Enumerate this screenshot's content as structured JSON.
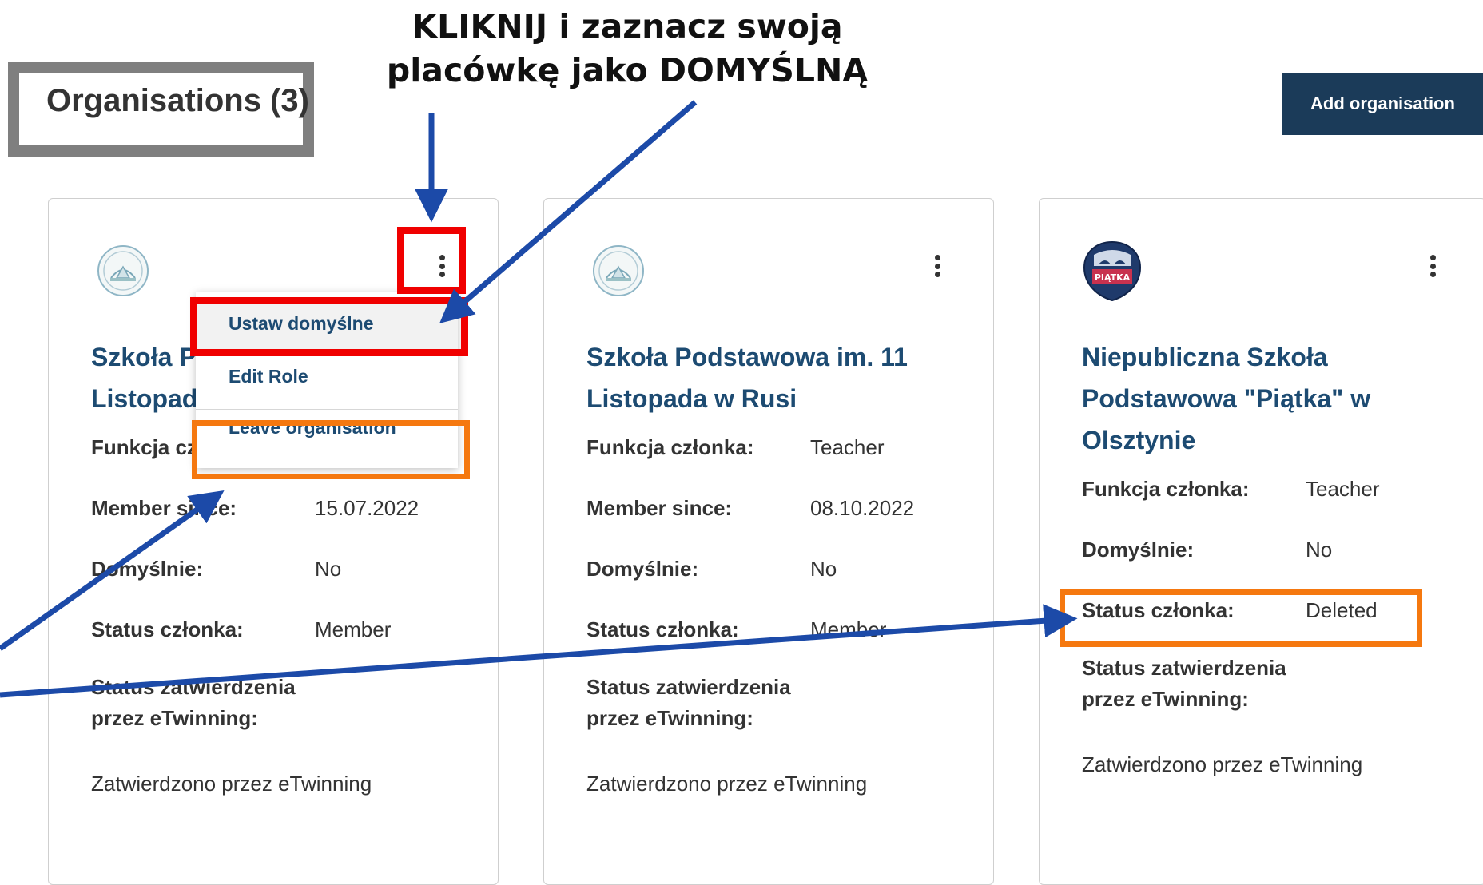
{
  "header": {
    "title": "Organisations (3)",
    "add_button": "Add organisation"
  },
  "annotation": {
    "line1": "KLIKNIJ i zaznacz swoją",
    "line2": "placówkę jako DOMYŚLNĄ"
  },
  "dropdown": {
    "items": [
      "Ustaw domyślne",
      "Edit Role",
      "Leave organisation"
    ]
  },
  "cards": [
    {
      "name_line1": "Szkoła P",
      "name_line2": "Listopad",
      "function_label": "Funkcja cz",
      "function_value": "",
      "member_since_label": "Member since:",
      "member_since_value": "15.07.2022",
      "default_label": "Domyślnie:",
      "default_value": "No",
      "status_label": "Status członka:",
      "status_value": "Member",
      "etwinning_label": "Status zatwierdzenia przez eTwinning:",
      "etwinning_value": "Zatwierdzono przez eTwinning"
    },
    {
      "name": "Szkoła Podstawowa im. 11 Listopada w Rusi",
      "function_label": "Funkcja członka:",
      "function_value": "Teacher",
      "member_since_label": "Member since:",
      "member_since_value": "08.10.2022",
      "default_label": "Domyślnie:",
      "default_value": "No",
      "status_label": "Status członka:",
      "status_value": "Member",
      "etwinning_label": "Status zatwierdzenia przez eTwinning:",
      "etwinning_value": "Zatwierdzono przez eTwinning"
    },
    {
      "name": "Niepubliczna Szkoła Podstawowa \"Piątka\" w Olsztynie",
      "logo_text": "PIĄTKA",
      "function_label": "Funkcja członka:",
      "function_value": "Teacher",
      "default_label": "Domyślnie:",
      "default_value": "No",
      "status_label": "Status członka:",
      "status_value": "Deleted",
      "etwinning_label": "Status zatwierdzenia przez eTwinning:",
      "etwinning_value": "Zatwierdzono przez eTwinning"
    }
  ],
  "colors": {
    "primary": "#1b3b59",
    "link": "#1d4b72",
    "highlight_red": "#f00000",
    "highlight_orange": "#f5780f",
    "arrow": "#1c4aa8",
    "title_frame": "#7f7f7f"
  }
}
